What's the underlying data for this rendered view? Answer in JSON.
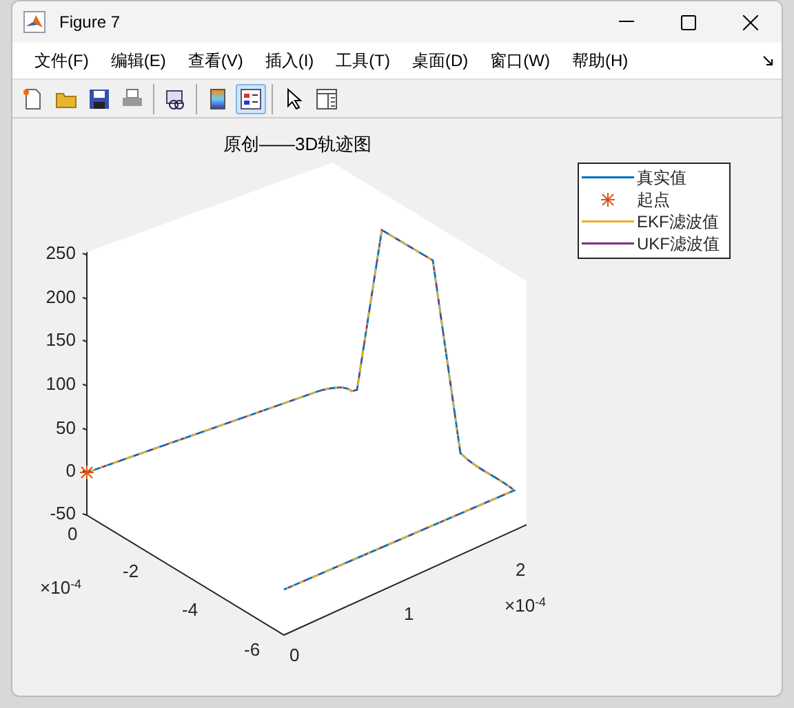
{
  "window": {
    "title": "Figure 7"
  },
  "menu": [
    {
      "label": "文件(F)"
    },
    {
      "label": "编辑(E)"
    },
    {
      "label": "查看(V)"
    },
    {
      "label": "插入(I)"
    },
    {
      "label": "工具(T)"
    },
    {
      "label": "桌面(D)"
    },
    {
      "label": "窗口(W)"
    },
    {
      "label": "帮助(H)"
    }
  ],
  "toolbar": [
    [
      {
        "kind": "new",
        "pressed": false
      },
      {
        "kind": "open",
        "pressed": false
      },
      {
        "kind": "save",
        "pressed": false
      },
      {
        "kind": "print",
        "pressed": false
      }
    ],
    [
      {
        "kind": "link",
        "pressed": false
      }
    ],
    [
      {
        "kind": "colorbar",
        "pressed": false
      },
      {
        "kind": "legend",
        "pressed": true
      }
    ],
    [
      {
        "kind": "pointer",
        "pressed": false
      },
      {
        "kind": "inspector",
        "pressed": false
      }
    ]
  ],
  "plot": {
    "title": "原创——3D轨迹图",
    "z_ticks": [
      "250",
      "200",
      "150",
      "100",
      "50",
      "0",
      "-50"
    ],
    "y_ticks": [
      "0",
      "-2",
      "-4",
      "-6"
    ],
    "x_ticks": [
      "0",
      "1",
      "2"
    ],
    "y_multiplier": {
      "base": "×10",
      "exponent": "-4"
    },
    "x_multiplier": {
      "base": "×10",
      "exponent": "-4"
    },
    "legend": [
      {
        "label": "真实值",
        "kind": "line",
        "color": "#0072bd"
      },
      {
        "label": "起点",
        "kind": "marker",
        "color": "#d95319"
      },
      {
        "label": "EKF滤波值",
        "kind": "line",
        "color": "#edb120"
      },
      {
        "label": "UKF滤波值",
        "kind": "line",
        "color": "#7e2f8e"
      }
    ]
  }
}
